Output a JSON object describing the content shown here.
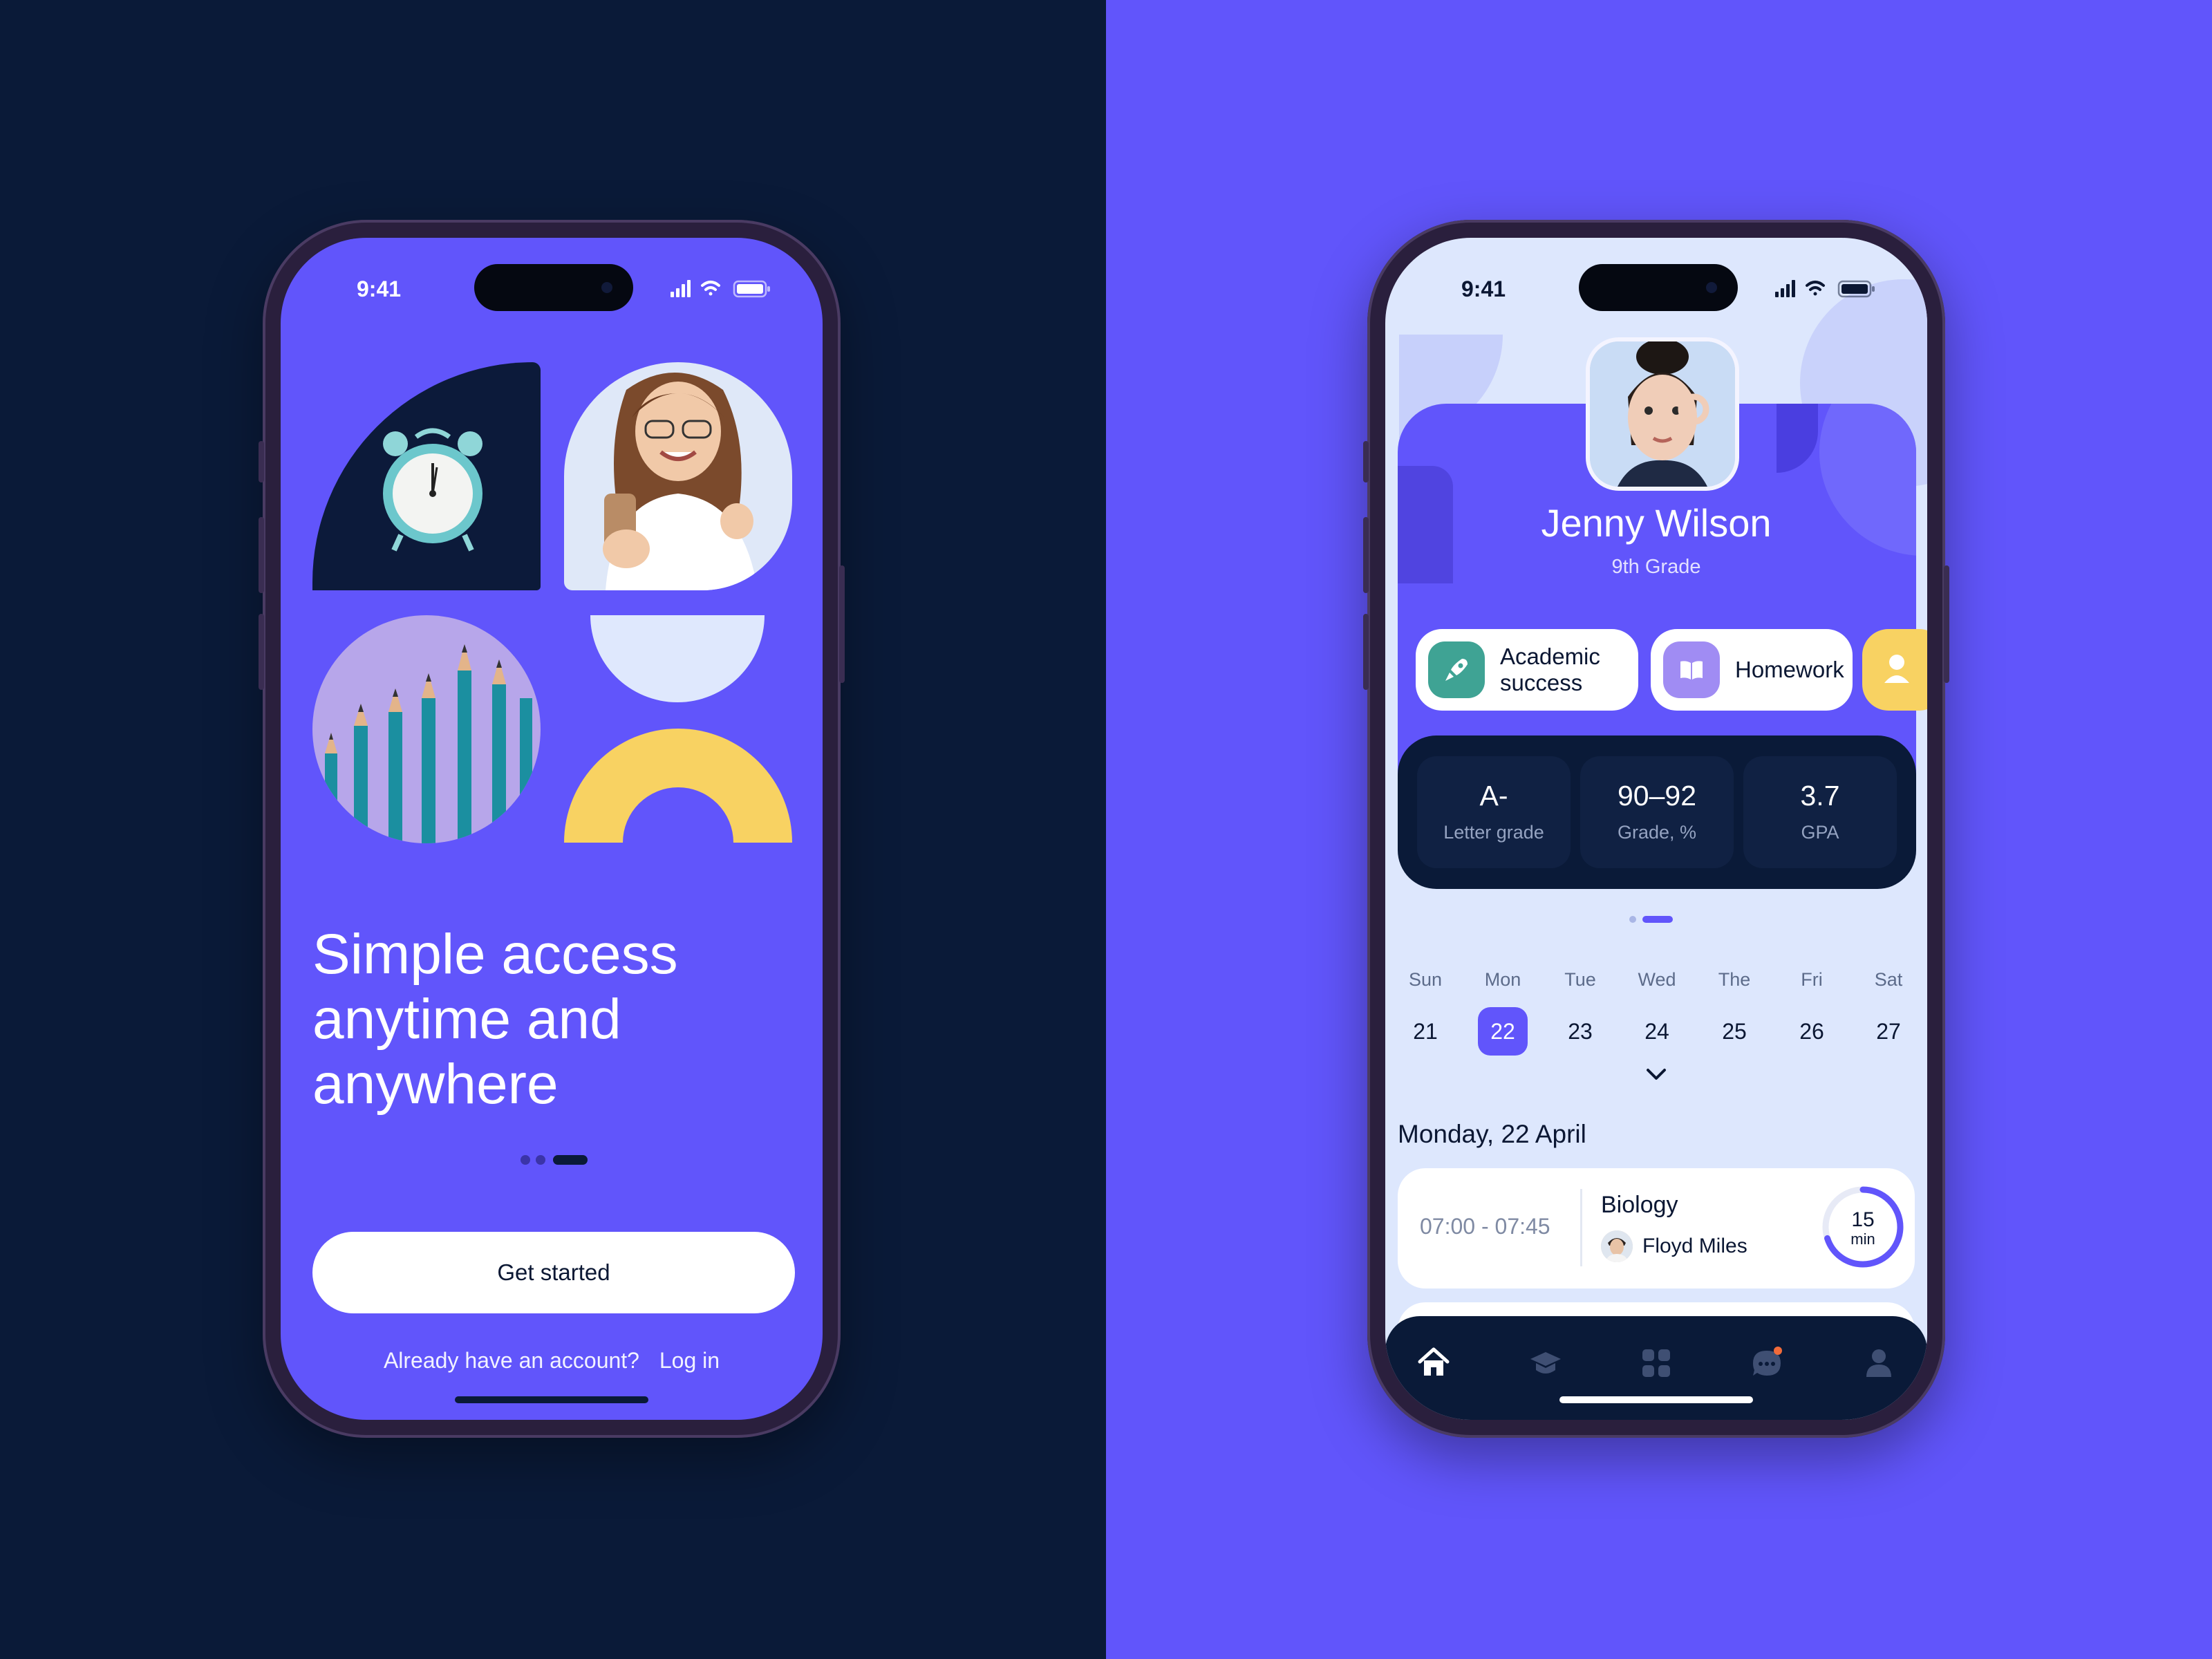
{
  "left_phone": {
    "status_time": "9:41",
    "headline_lines": [
      "Simple access",
      "anytime and",
      "anywhere"
    ],
    "page_indicator": {
      "count": 3,
      "active": 3
    },
    "primary_button": "Get started",
    "login_prompt": "Already have an account?",
    "login_link": "Log in",
    "colors": {
      "accent": "#6155fb",
      "navy": "#0a1a38",
      "yellow": "#f8d262",
      "light": "#dfe8fd"
    },
    "tile_icons": [
      "alarm-clock-icon",
      "woman-with-phone-photo",
      "pencils-photo"
    ]
  },
  "right_phone": {
    "status_time": "9:41",
    "profile": {
      "name": "Jenny Wilson",
      "grade": "9th Grade"
    },
    "chips": [
      {
        "label_line1": "Academic",
        "label_line2": "success",
        "icon": "rocket-icon",
        "color": "#3fa394"
      },
      {
        "label": "Homework",
        "icon": "book-icon",
        "color": "#a08cf3"
      },
      {
        "label": "",
        "icon": "user-icon",
        "color": "#f8d262"
      }
    ],
    "stats": [
      {
        "value": "A-",
        "label": "Letter grade"
      },
      {
        "value": "90–92",
        "label": "Grade, %"
      },
      {
        "value": "3.7",
        "label": "GPA"
      }
    ],
    "stats_indicator": {
      "count": 2,
      "active": 2
    },
    "week": [
      {
        "name": "Sun",
        "date": "21"
      },
      {
        "name": "Mon",
        "date": "22"
      },
      {
        "name": "Tue",
        "date": "23"
      },
      {
        "name": "Wed",
        "date": "24"
      },
      {
        "name": "The",
        "date": "25"
      },
      {
        "name": "Fri",
        "date": "26"
      },
      {
        "name": "Sat",
        "date": "27"
      }
    ],
    "selected_day": "22",
    "date_heading": "Monday, 22 April",
    "lesson": {
      "time": "07:00 - 07:45",
      "subject": "Biology",
      "teacher": "Floyd Miles",
      "timer_value": "15",
      "timer_unit": "min",
      "timer_progress": 0.7
    },
    "tabs": [
      "home-icon",
      "graduation-cap-icon",
      "grid-icon",
      "chat-icon",
      "profile-icon"
    ],
    "active_tab": "home-icon",
    "chat_badge_color": "#f26b3a"
  }
}
